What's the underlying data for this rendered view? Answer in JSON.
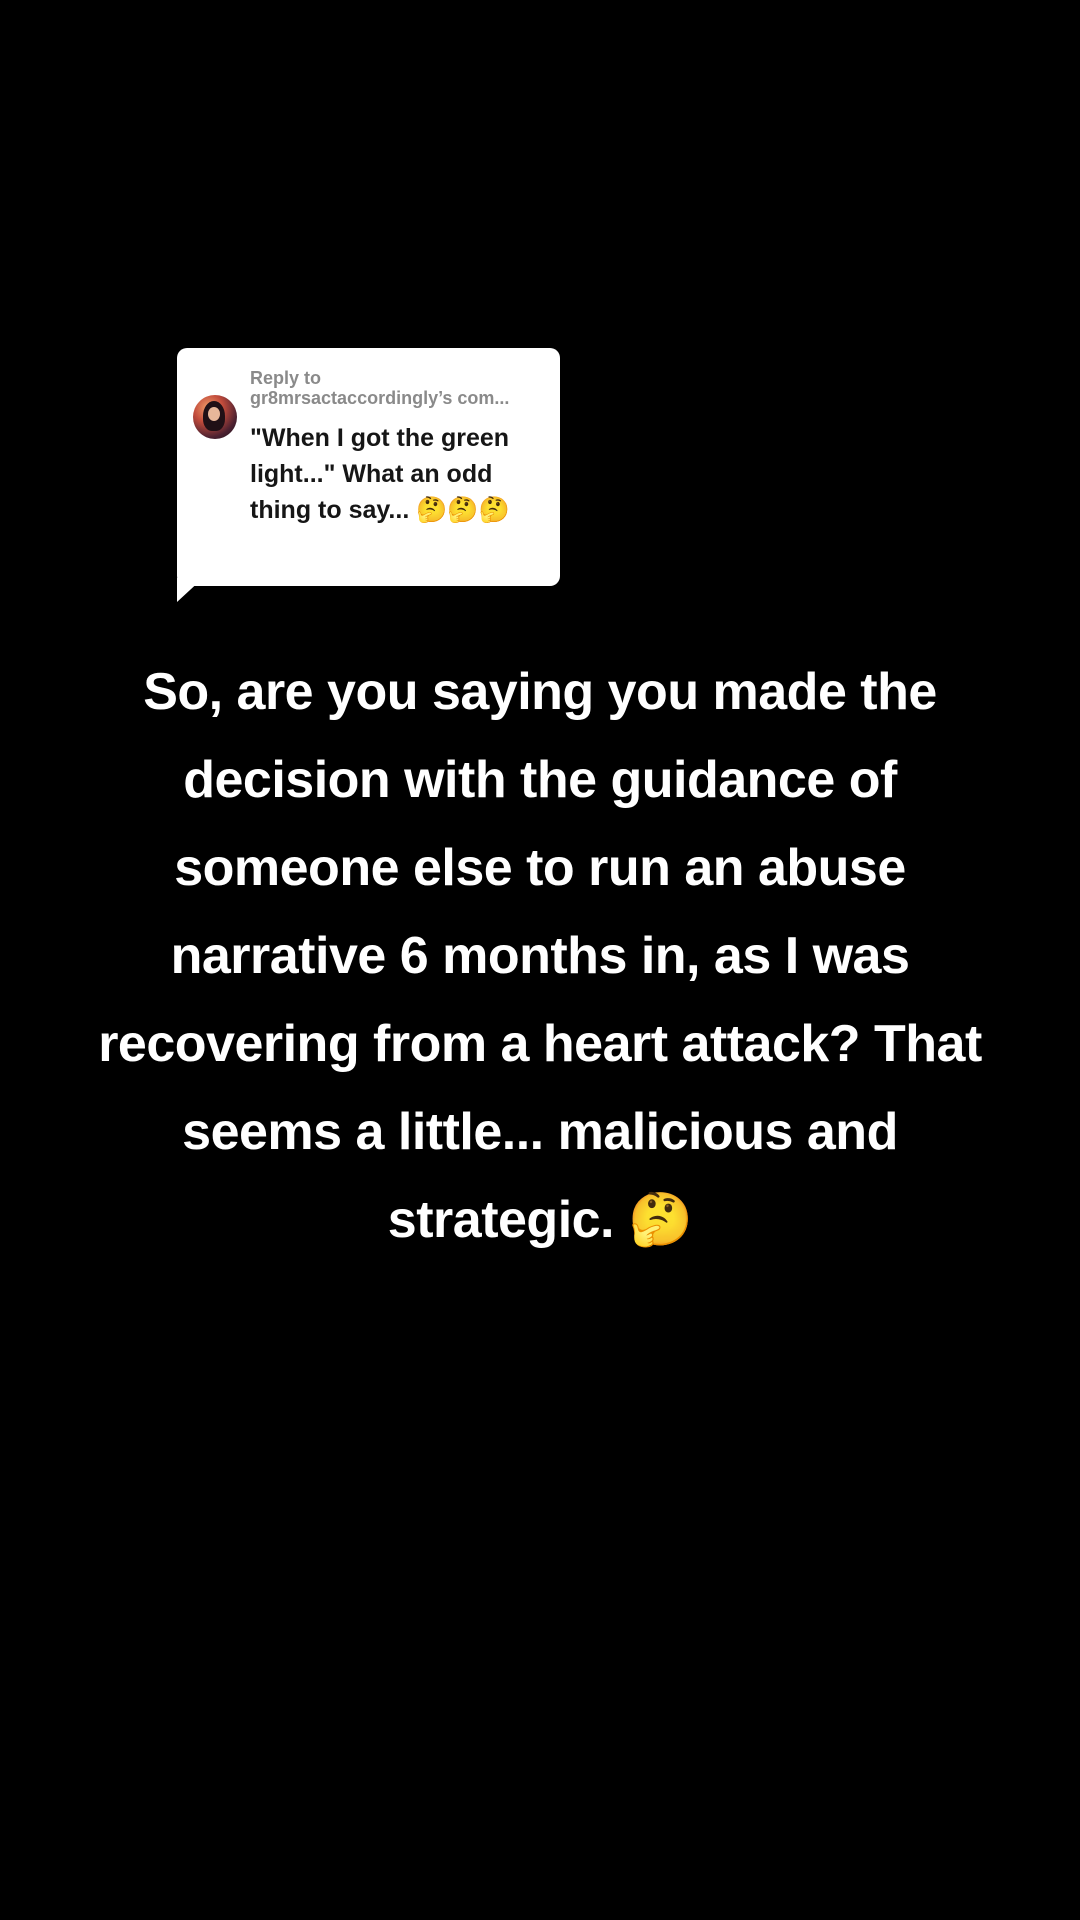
{
  "reply": {
    "label": "Reply to",
    "handle": "gr8mrsactaccordingly’s com...",
    "comment": "\"When I got the green light...\" What an odd thing to say... 🤔🤔🤔",
    "avatar_icon": "user-avatar"
  },
  "caption": {
    "text": "So, are you saying you made the decision with the guidance of someone else to run an abuse narrative 6 months in, as I was recovering from a heart attack? That seems a little... malicious and strategic. 🤔"
  },
  "colors": {
    "background": "#000000",
    "card": "#ffffff",
    "caption_text": "#ffffff",
    "reply_label": "#8a8a8a"
  }
}
